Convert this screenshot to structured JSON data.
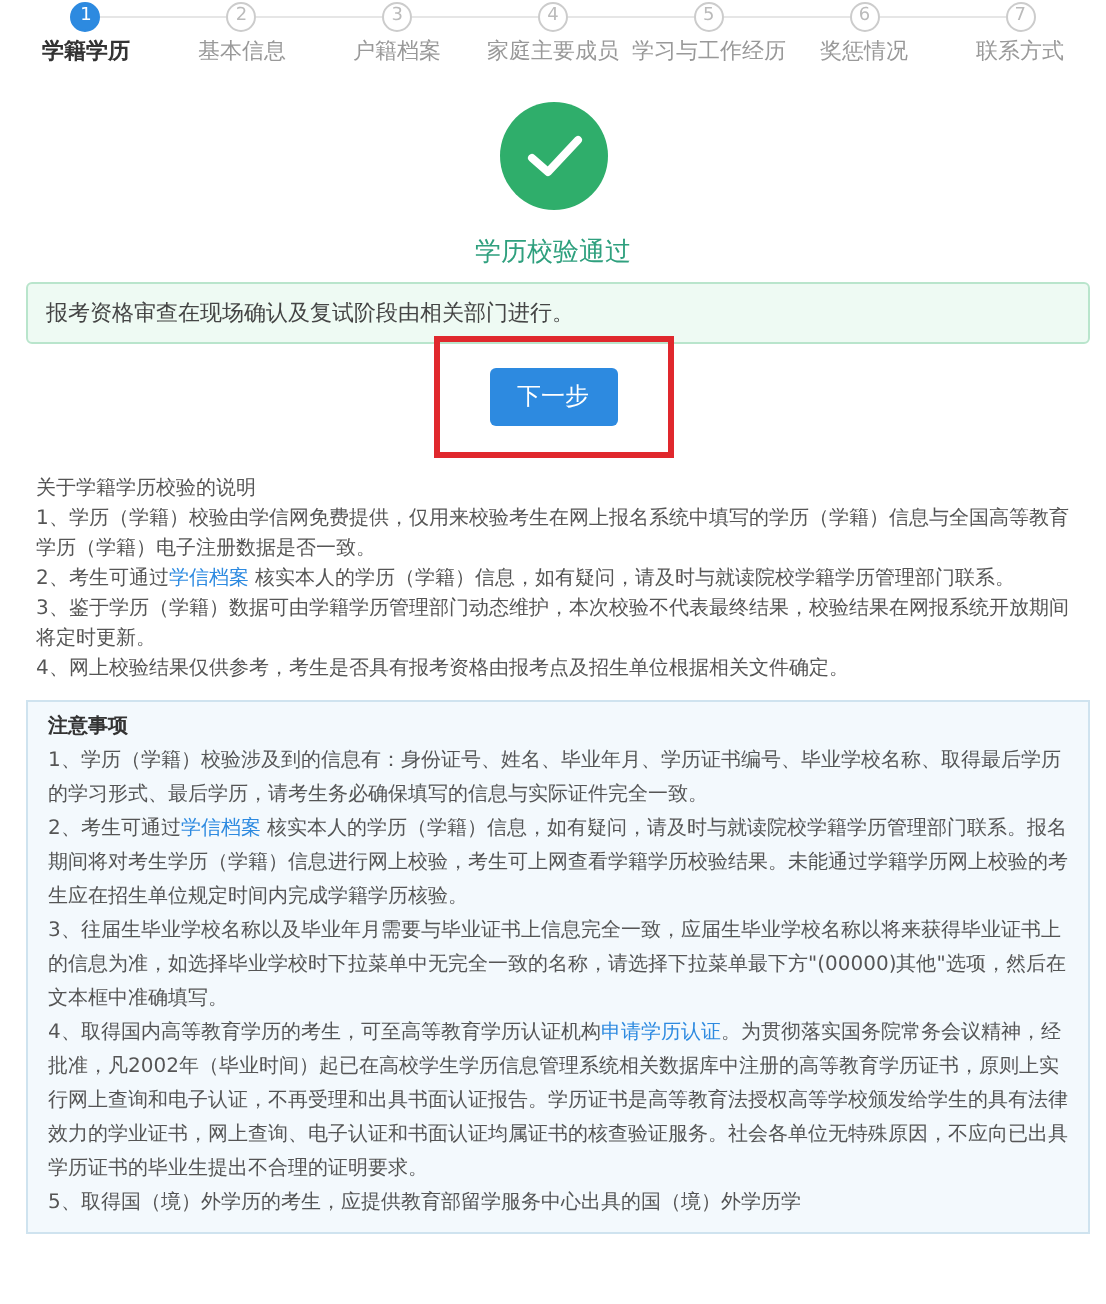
{
  "steps": [
    {
      "number": "1",
      "label": "学籍学历",
      "selected": true
    },
    {
      "number": "2",
      "label": "基本信息",
      "selected": false
    },
    {
      "number": "3",
      "label": "户籍档案",
      "selected": false
    },
    {
      "number": "4",
      "label": "家庭主要成员",
      "selected": false
    },
    {
      "number": "5",
      "label": "学习与工作经历",
      "selected": false
    },
    {
      "number": "6",
      "label": "奖惩情况",
      "selected": false
    },
    {
      "number": "7",
      "label": "联系方式",
      "selected": false
    }
  ],
  "result": {
    "title": "学历校验通过",
    "alert": "报考资格审查在现场确认及复试阶段由相关部门进行。",
    "next_button": {
      "label": "下一步",
      "highlighted": true
    }
  },
  "explanation": {
    "title": "关于学籍学历校验的说明",
    "items": [
      [
        {
          "text": "1、学历（学籍）校验由学信网免费提供，仅用来校验考生在网上报名系统中填写的学历（学籍）信息与全国高等教育学历（学籍）电子注册数据是否一致。"
        }
      ],
      [
        {
          "text": "2、考生可通过"
        },
        {
          "text": "学信档案",
          "link": true
        },
        {
          "text": " 核实本人的学历（学籍）信息，如有疑问，请及时与就读院校学籍学历管理部门联系。"
        }
      ],
      [
        {
          "text": "3、鉴于学历（学籍）数据可由学籍学历管理部门动态维护，本次校验不代表最终结果，校验结果在网报系统开放期间将定时更新。"
        }
      ],
      [
        {
          "text": "4、网上校验结果仅供参考，考生是否具有报考资格由报考点及招生单位根据相关文件确定。"
        }
      ]
    ]
  },
  "notice": {
    "title": "注意事项",
    "items": [
      [
        {
          "text": "1、学历（学籍）校验涉及到的信息有：身份证号、姓名、毕业年月、学历证书编号、毕业学校名称、取得最后学历的学习形式、最后学历，请考生务必确保填写的信息与实际证件完全一致。"
        }
      ],
      [
        {
          "text": "2、考生可通过"
        },
        {
          "text": "学信档案",
          "link": true
        },
        {
          "text": " 核实本人的学历（学籍）信息，如有疑问，请及时与就读院校学籍学历管理部门联系。报名期间将对考生学历（学籍）信息进行网上校验，考生可上网查看学籍学历校验结果。未能通过学籍学历网上校验的考生应在招生单位规定时间内完成学籍学历核验。"
        }
      ],
      [
        {
          "text": "3、往届生毕业学校名称以及毕业年月需要与毕业证书上信息完全一致，应届生毕业学校名称以将来获得毕业证书上的信息为准，如选择毕业学校时下拉菜单中无完全一致的名称，请选择下拉菜单最下方\"(00000)其他\"选项，然后在文本框中准确填写。"
        }
      ],
      [
        {
          "text": "4、取得国内高等教育学历的考生，可至高等教育学历认证机构"
        },
        {
          "text": "申请学历认证",
          "link": true
        },
        {
          "text": "。为贯彻落实国务院常务会议精神，经批准，凡2002年（毕业时间）起已在高校学生学历信息管理系统相关数据库中注册的高等教育学历证书，原则上实行网上查询和电子认证，不再受理和出具书面认证报告。学历证书是高等教育法授权高等学校颁发给学生的具有法律效力的学业证书，网上查询、电子认证和书面认证均属证书的核查验证服务。社会各单位无特殊原因，不应向已出具学历证书的毕业生提出不合理的证明要求。"
        }
      ],
      [
        {
          "text": "5、取得国（境）外学历的考生，应提供教育部留学服务中心出具的国（境）外学历学"
        }
      ]
    ]
  }
}
